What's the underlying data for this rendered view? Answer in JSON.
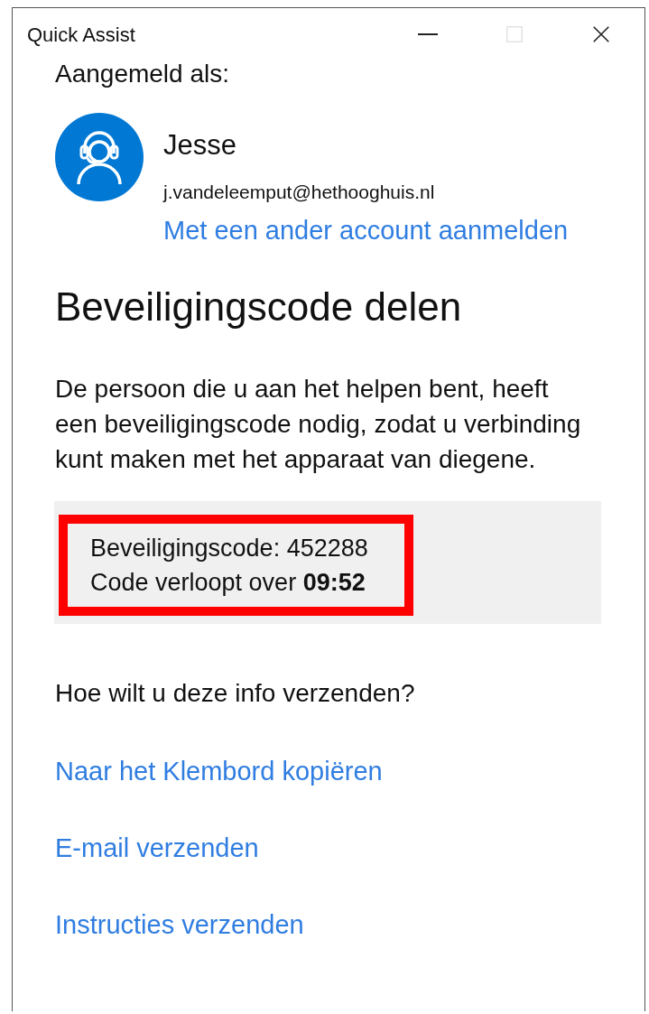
{
  "window": {
    "title": "Quick Assist",
    "controls": [
      {
        "kind": "minimize",
        "disabled": false
      },
      {
        "kind": "maximize",
        "disabled": true
      },
      {
        "kind": "close",
        "disabled": false
      }
    ]
  },
  "account": {
    "label": "Aangemeld als:",
    "name": "Jesse",
    "email": "j.vandeleemput@hethooghuis.nl",
    "switch_link": "Met een ander account aanmelden"
  },
  "heading": "Beveiligingscode delen",
  "description": "De persoon die u aan het helpen bent, heeft een beveiligingscode nodig, zodat u verbinding kunt maken met het apparaat van diegene.",
  "code_panel": {
    "highlighted": true,
    "code_line": "Beveiligingscode: 452288",
    "expiry_line": "Code verloopt over **09:52**"
  },
  "send_prompt": "Hoe wilt u deze info verzenden?",
  "send_options": [
    "Naar het Klembord kopiëren",
    "E-mail verzenden",
    "Instructies verzenden"
  ]
}
